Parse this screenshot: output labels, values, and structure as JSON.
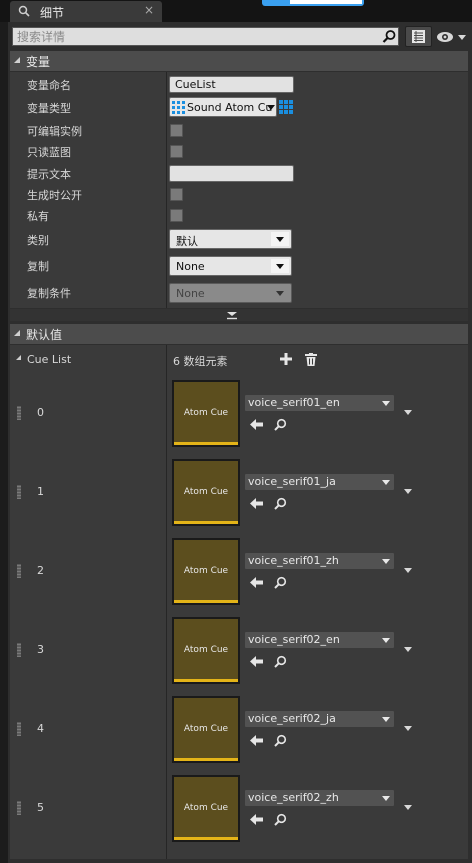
{
  "tab": {
    "title": "细节",
    "close": "×",
    "icon": "details-icon"
  },
  "search": {
    "placeholder": "搜索详情",
    "value": ""
  },
  "sections": {
    "variable": "变量",
    "default_value": "默认值"
  },
  "variable_rows": {
    "name": {
      "label": "变量命名",
      "value": "CueList"
    },
    "type": {
      "label": "变量类型",
      "value": "Sound Atom Cu"
    },
    "instance_editable": {
      "label": "可编辑实例",
      "checked": false
    },
    "blueprint_readonly": {
      "label": "只读蓝图",
      "checked": false
    },
    "tooltip": {
      "label": "提示文本",
      "value": ""
    },
    "expose_on_spawn": {
      "label": "生成时公开",
      "checked": false
    },
    "private": {
      "label": "私有",
      "checked": false
    },
    "category": {
      "label": "类别",
      "value": "默认"
    },
    "replication": {
      "label": "复制",
      "value": "None"
    },
    "replication_condition": {
      "label": "复制条件",
      "value": "None"
    }
  },
  "default_value": {
    "array_label": "Cue List",
    "count_text": "6 数组元素",
    "elements": [
      {
        "index": "0",
        "thumb_label": "Atom Cue",
        "asset": "voice_serif01_en"
      },
      {
        "index": "1",
        "thumb_label": "Atom Cue",
        "asset": "voice_serif01_ja"
      },
      {
        "index": "2",
        "thumb_label": "Atom Cue",
        "asset": "voice_serif01_zh"
      },
      {
        "index": "3",
        "thumb_label": "Atom Cue",
        "asset": "voice_serif02_en"
      },
      {
        "index": "4",
        "thumb_label": "Atom Cue",
        "asset": "voice_serif02_ja"
      },
      {
        "index": "5",
        "thumb_label": "Atom Cue",
        "asset": "voice_serif02_zh"
      }
    ]
  },
  "colors": {
    "thumb_fill": "#5c4e1e",
    "thumb_bar": "#e4b418",
    "accent_blue": "#3aa0f0",
    "type_icon": "#1a8fe0"
  }
}
